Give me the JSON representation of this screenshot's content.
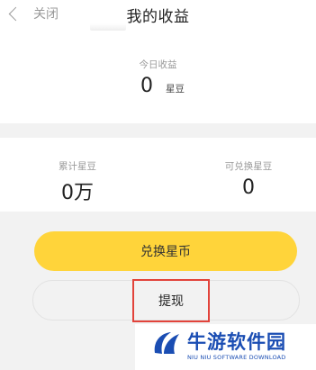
{
  "header": {
    "close_label": "关闭",
    "title": "我的收益"
  },
  "today": {
    "label": "今日收益",
    "value": "0",
    "unit": "星豆"
  },
  "stats": {
    "total": {
      "label": "累计星豆",
      "value": "0万"
    },
    "exchangeable": {
      "label": "可兑换星豆",
      "value": "0"
    }
  },
  "actions": {
    "exchange_label": "兑换星币",
    "withdraw_label": "提现"
  },
  "watermark": {
    "name": "牛游软件园",
    "subtitle": "NIU NIU SOFTWARE DOWNLOAD"
  },
  "colors": {
    "accent": "#ffd43a",
    "highlight": "#e2433b",
    "watermark": "#1a4db3"
  }
}
